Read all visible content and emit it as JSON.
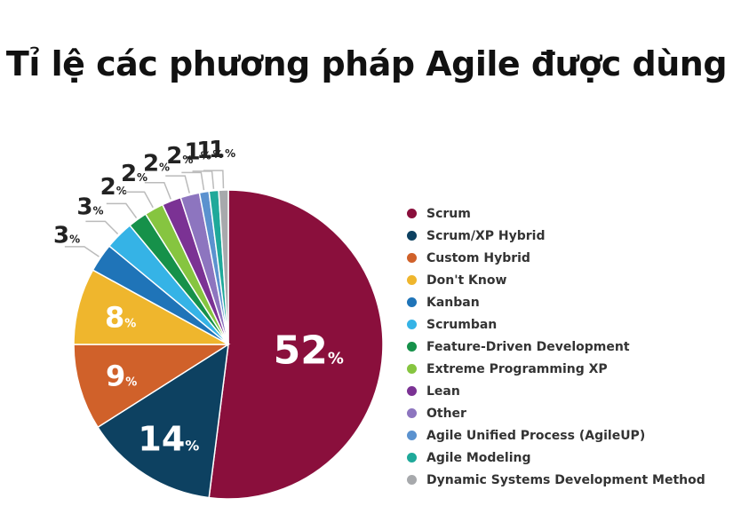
{
  "chart_data": {
    "type": "pie",
    "title": "Tỉ lệ các phương pháp Agile được dùng",
    "percent_sign": "%",
    "legend_position": "right",
    "slices": [
      {
        "label": "Scrum",
        "value": 52,
        "display": "52",
        "color": "#8a0f3c"
      },
      {
        "label": "Scrum/XP Hybrid",
        "value": 14,
        "display": "14",
        "color": "#0d4161"
      },
      {
        "label": "Custom Hybrid",
        "value": 9,
        "display": "9",
        "color": "#d0612a"
      },
      {
        "label": "Don't Know",
        "value": 8,
        "display": "8",
        "color": "#efb62d"
      },
      {
        "label": "Kanban",
        "value": 3,
        "display": "3",
        "color": "#1f74b8"
      },
      {
        "label": "Scrumban",
        "value": 3,
        "display": "3",
        "color": "#35b3e6"
      },
      {
        "label": "Feature-Driven Development",
        "value": 2,
        "display": "2",
        "color": "#16914a"
      },
      {
        "label": "Extreme Programming XP",
        "value": 2,
        "display": "2",
        "color": "#86c540"
      },
      {
        "label": "Lean",
        "value": 2,
        "display": "2",
        "color": "#7b3294"
      },
      {
        "label": "Other",
        "value": 2,
        "display": "2",
        "color": "#8d75bf"
      },
      {
        "label": "Agile Unified Process (AgileUP)",
        "value": 1,
        "display": "1",
        "color": "#5b92cf"
      },
      {
        "label": "Agile Modeling",
        "value": 1,
        "display": "1",
        "color": "#1fa99a"
      },
      {
        "label": "Dynamic Systems Development Method",
        "value": 1,
        "display": "1",
        "color": "#a7a9ac"
      }
    ]
  }
}
